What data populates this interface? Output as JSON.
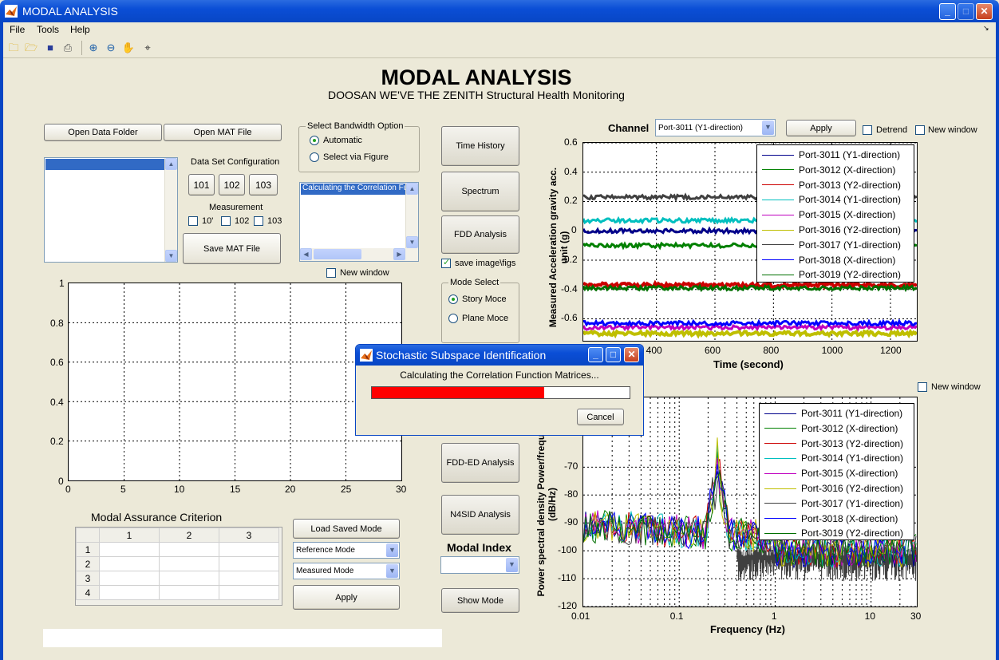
{
  "window": {
    "title": "MODAL ANALYSIS",
    "buttons": {
      "minimize": "_",
      "maximize": "□",
      "close": "✕"
    }
  },
  "menu": [
    "File",
    "Tools",
    "Help"
  ],
  "toolbar_icons": [
    "new-folder-icon",
    "open-folder-icon",
    "save-icon",
    "print-icon",
    "zoom-in-icon",
    "zoom-out-icon",
    "pan-hand-icon",
    "data-cursor-icon"
  ],
  "header": {
    "title": "MODAL ANALYSIS",
    "subtitle": "DOOSAN WE'VE THE ZENITH Structural Health Monitoring"
  },
  "buttons": {
    "open_data_folder": "Open Data Folder",
    "open_mat_file": "Open MAT File",
    "ds101": "101",
    "ds102": "102",
    "ds103": "103",
    "save_mat_file": "Save MAT File",
    "time_history": "Time History",
    "spectrum": "Spectrum",
    "fdd_analysis": "FDD Analysis",
    "fdd_ed_analysis": "FDD-ED Analysis",
    "n4sid_analysis": "N4SID Analysis",
    "show_mode": "Show Mode",
    "load_saved_mode": "Load Saved Mode",
    "apply_mode": "Apply",
    "apply_channel": "Apply"
  },
  "labels": {
    "data_set_config": "Data Set Configuration",
    "measurement": "Measurement",
    "m101": "10'",
    "m102": "102",
    "m103": "103",
    "bandwidth_group": "Select Bandwidth Option",
    "automatic": "Automatic",
    "select_via_figure": "Select via Figure",
    "new_window_1": "New window",
    "save_image": "save image\\figs",
    "mode_select": "Mode Select",
    "story_mode": "Story Moce",
    "plane_mode": "Plane Moce",
    "channel": "Channel",
    "detrend": "Detrend",
    "new_window_2": "New window",
    "new_window_3": "New window",
    "modal_index": "Modal Index",
    "mac_title": "Modal Assurance Criterion"
  },
  "status_list": {
    "item": "Calculating the Correlation Function"
  },
  "channel_select": {
    "value": "Port-3011 (Y1-direction)"
  },
  "reference_mode": {
    "value": "Reference Mode"
  },
  "measured_mode": {
    "value": "Measured Mode"
  },
  "modal_index_select": {
    "value": ""
  },
  "mac_table": {
    "columns": [
      "1",
      "2",
      "3"
    ],
    "rows": [
      "1",
      "2",
      "3",
      "4"
    ]
  },
  "mode_axes": {
    "xticks": [
      "0",
      "5",
      "10",
      "15",
      "20",
      "25",
      "30"
    ],
    "yticks": [
      "0",
      "0.2",
      "0.4",
      "0.6",
      "0.8",
      "1"
    ]
  },
  "colors": {
    "window_blue": "#0a4ed6",
    "series": [
      "#00008b",
      "#008000",
      "#cc0000",
      "#00bfbf",
      "#bf00bf",
      "#bfbf00",
      "#404040",
      "#0000ff",
      "#007000"
    ],
    "progress": "#ff0000"
  },
  "chart_data": [
    {
      "type": "line",
      "xlabel": "Time (second)",
      "ylabel": "Measured Acceleration gravity acc. unit (g)",
      "xticks": [
        "400",
        "600",
        "800",
        "1000",
        "1200"
      ],
      "yticks": [
        "0.6",
        "0.4",
        "0.2",
        "0",
        "-0.2",
        "-0.4",
        "-0.6"
      ],
      "xlim": [
        150,
        1290
      ],
      "ylim": [
        -0.75,
        0.6
      ],
      "series": [
        {
          "name": "Port-3011 (Y1-direction)",
          "level": 0.0
        },
        {
          "name": "Port-3012 (X-direction)",
          "level": -0.1
        },
        {
          "name": "Port-3013 (Y2-direction)",
          "level": -0.37
        },
        {
          "name": "Port-3014 (Y1-direction)",
          "level": 0.07
        },
        {
          "name": "Port-3015 (X-direction)",
          "level": -0.66
        },
        {
          "name": "Port-3016 (Y2-direction)",
          "level": -0.7
        },
        {
          "name": "Port-3017 (Y1-direction)",
          "level": 0.23
        },
        {
          "name": "Port-3018 (X-direction)",
          "level": -0.63
        },
        {
          "name": "Port-3019 (Y2-direction)",
          "level": -0.39
        }
      ]
    },
    {
      "type": "line",
      "xlabel": "Frequency (Hz)",
      "ylabel": "Power spectral density Power/frequency (dB/Hz)",
      "xscale": "log",
      "xticks": [
        "0.01",
        "0.1",
        "1",
        "10",
        "30"
      ],
      "yticks": [
        "-70",
        "-80",
        "-90",
        "-100",
        "-110",
        "-120"
      ],
      "xlim": [
        0.01,
        30
      ],
      "ylim": [
        -120,
        -45
      ],
      "series": [
        {
          "name": "Port-3011 (Y1-direction)"
        },
        {
          "name": "Port-3012 (X-direction)"
        },
        {
          "name": "Port-3013 (Y2-direction)"
        },
        {
          "name": "Port-3014 (Y1-direction)"
        },
        {
          "name": "Port-3015 (X-direction)"
        },
        {
          "name": "Port-3016 (Y2-direction)"
        },
        {
          "name": "Port-3017 (Y1-direction)"
        },
        {
          "name": "Port-3018 (X-direction)"
        },
        {
          "name": "Port-3019 (Y2-direction)"
        }
      ]
    }
  ],
  "dialog": {
    "title": "Stochastic Subspace Identification",
    "message": "Calculating the Correlation Function Matrices...",
    "progress": 0.67,
    "cancel": "Cancel"
  }
}
